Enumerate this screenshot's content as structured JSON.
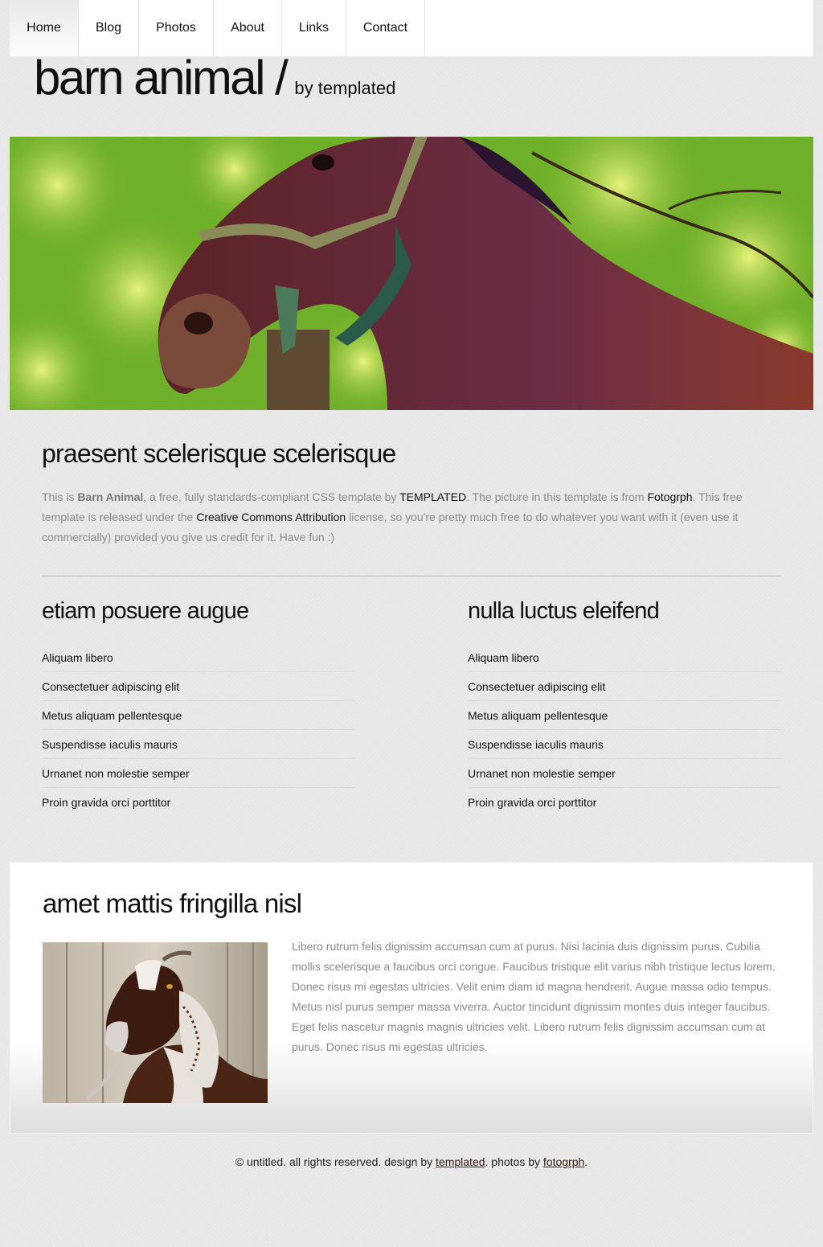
{
  "nav": {
    "items": [
      {
        "label": "Home"
      },
      {
        "label": "Blog"
      },
      {
        "label": "Photos"
      },
      {
        "label": "About"
      },
      {
        "label": "Links"
      },
      {
        "label": "Contact"
      }
    ]
  },
  "logo": {
    "title": "barn animal /",
    "subtitle": "by templated"
  },
  "intro": {
    "title": "praesent scelerisque scelerisque",
    "text_1": "This is ",
    "brand": "Barn Animal",
    "text_2": ", a free, fully standards-compliant CSS template by ",
    "link_templated": "TEMPLATED",
    "text_3": ". The picture in this template is from ",
    "link_fotogrph": "Fotogrph",
    "text_4": ". This free template is released under the ",
    "link_license": "Creative Commons Attribution",
    "text_5": " license, so you're pretty much free to do whatever you want with it (even use it commercially) provided you give us credit for it. Have fun :)"
  },
  "columns": [
    {
      "title": "etiam posuere augue",
      "items": [
        "Aliquam libero",
        "Consectetuer adipiscing elit",
        "Metus aliquam pellentesque",
        "Suspendisse iaculis mauris",
        "Urnanet non molestie semper",
        "Proin gravida orci porttitor"
      ]
    },
    {
      "title": "nulla luctus eleifend",
      "items": [
        "Aliquam libero",
        "Consectetuer adipiscing elit",
        "Metus aliquam pellentesque",
        "Suspendisse iaculis mauris",
        "Urnanet non molestie semper",
        "Proin gravida orci porttitor"
      ]
    }
  ],
  "feature": {
    "title": "amet mattis fringilla nisl",
    "text": "Libero rutrum felis dignissim accumsan cum at purus. Nisi lacinia duis dignissim purus. Cubilia mollis scelerisque a faucibus orci congue. Faucibus tristique elit varius nibh tristique lectus lorem. Donec risus mi egestas ultricies. Velit enim diam id magna hendrerit. Augue massa odio tempus. Metus nisl purus semper massa viverra. Auctor tincidunt dignissim montes duis integer faucibus. Eget felis nascetur magnis magnis ultricies velit. Libero rutrum felis dignissim accumsan cum at purus. Donec risus mi egestas ultricies."
  },
  "footer": {
    "text_1": "© untitled. all rights reserved. design by ",
    "link_templated": "templated",
    "text_2": ". photos by ",
    "link_fotogrph": "fotogrph",
    "text_3": "."
  },
  "colors": {
    "background": "#e8e8e8",
    "text_muted": "#8a8a8a",
    "heading": "#111111",
    "link_footer": "#3a1a0a"
  }
}
